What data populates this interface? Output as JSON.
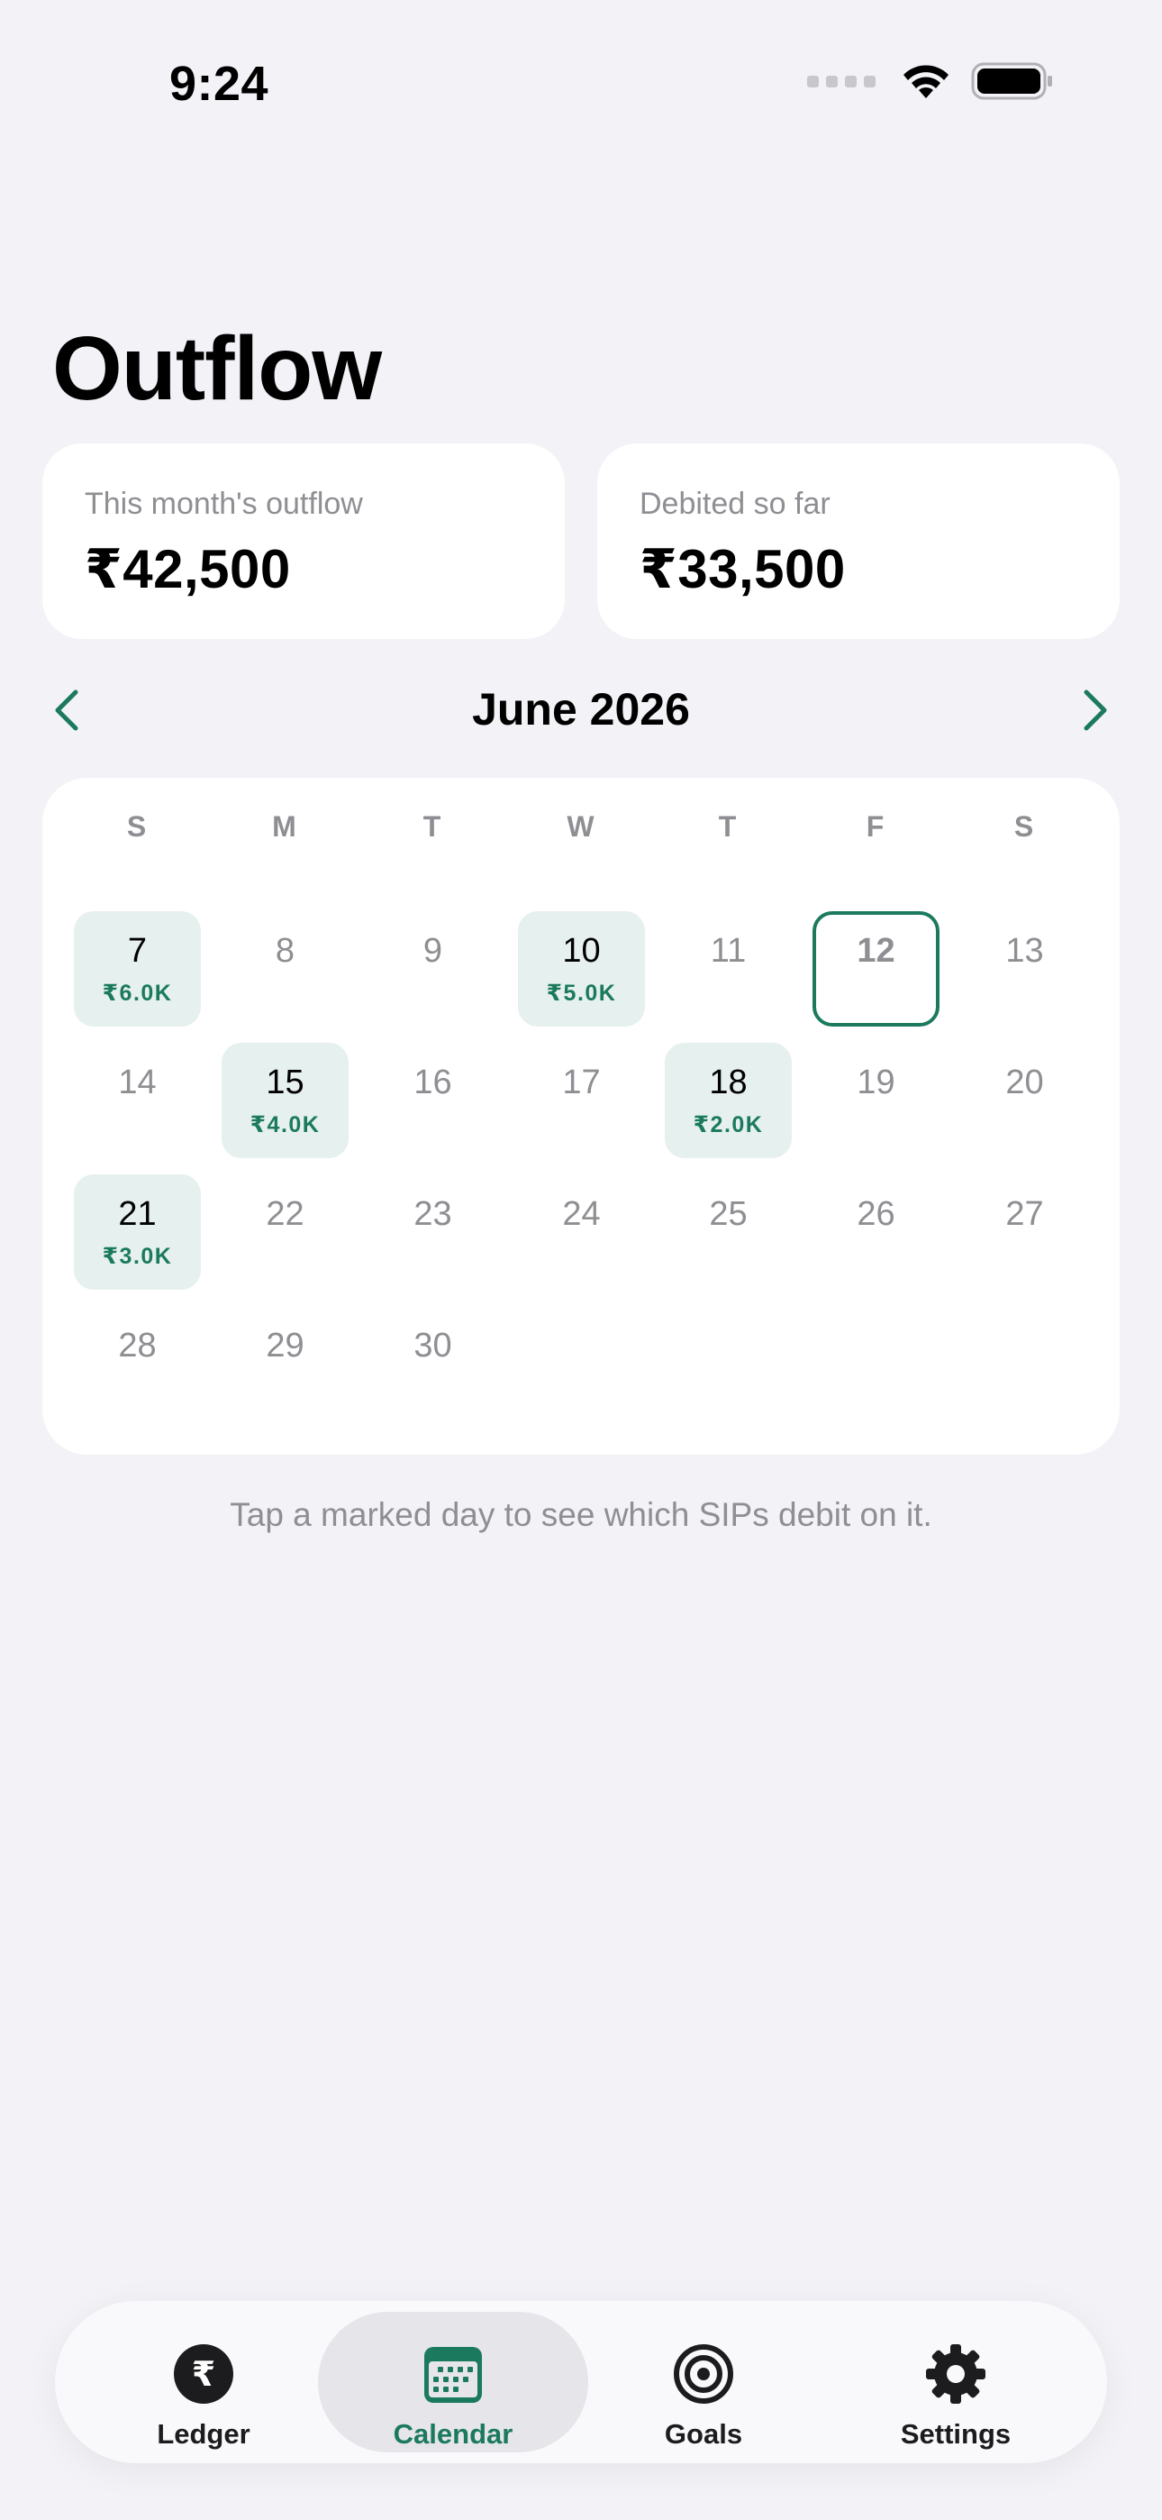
{
  "status_bar": {
    "time": "9:24"
  },
  "header": {
    "title": "Outflow"
  },
  "summary": {
    "monthly_outflow": {
      "label": "This month's outflow",
      "value": "₹42,500"
    },
    "debited_so_far": {
      "label": "Debited so far",
      "value": "₹33,500"
    }
  },
  "calendar": {
    "month_label": "June 2026",
    "weekdays": [
      "S",
      "M",
      "T",
      "W",
      "T",
      "F",
      "S"
    ],
    "days": [
      {
        "n": "7",
        "amount": "₹6.0K"
      },
      {
        "n": "8"
      },
      {
        "n": "9"
      },
      {
        "n": "10",
        "amount": "₹5.0K"
      },
      {
        "n": "11"
      },
      {
        "n": "12",
        "today": true
      },
      {
        "n": "13"
      },
      {
        "n": "14"
      },
      {
        "n": "15",
        "amount": "₹4.0K"
      },
      {
        "n": "16"
      },
      {
        "n": "17"
      },
      {
        "n": "18",
        "amount": "₹2.0K"
      },
      {
        "n": "19"
      },
      {
        "n": "20"
      },
      {
        "n": "21",
        "amount": "₹3.0K"
      },
      {
        "n": "22"
      },
      {
        "n": "23"
      },
      {
        "n": "24"
      },
      {
        "n": "25"
      },
      {
        "n": "26"
      },
      {
        "n": "27"
      },
      {
        "n": "28"
      },
      {
        "n": "29"
      },
      {
        "n": "30"
      }
    ]
  },
  "hint": "Tap a marked day to see which SIPs debit on it.",
  "tabs": [
    {
      "label": "Ledger",
      "icon": "rupee-circle-icon"
    },
    {
      "label": "Calendar",
      "icon": "calendar-icon",
      "active": true
    },
    {
      "label": "Goals",
      "icon": "target-icon"
    },
    {
      "label": "Settings",
      "icon": "gear-icon"
    }
  ],
  "colors": {
    "accent": "#1b7a5e",
    "marked_day_bg": "#e6f0ee",
    "background": "#f2f2f7",
    "muted_text": "#8e8e93"
  }
}
